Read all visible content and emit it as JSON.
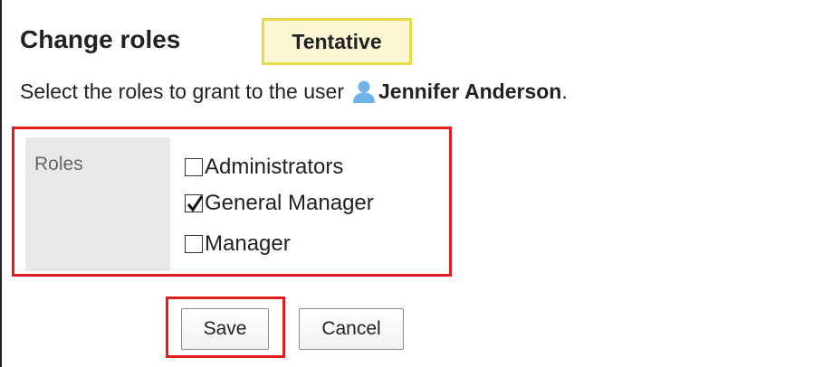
{
  "header": {
    "title": "Change roles",
    "status_badge": "Tentative"
  },
  "description": {
    "prefix": "Select the roles to grant to the user",
    "user_name": "Jennifer Anderson",
    "suffix": ".",
    "user_icon": "user-icon"
  },
  "roles": {
    "label": "Roles",
    "options": [
      {
        "label": "Administrators",
        "checked": false
      },
      {
        "label": "General Manager",
        "checked": true
      },
      {
        "label": "Manager",
        "checked": false
      }
    ]
  },
  "buttons": {
    "save_label": "Save",
    "cancel_label": "Cancel"
  },
  "colors": {
    "highlight_border": "#e01e1e",
    "badge_border": "#e8d94a",
    "badge_background": "#fbf7d5",
    "label_cell_background": "#e8e8e8",
    "user_icon": "#6fb3e8"
  }
}
